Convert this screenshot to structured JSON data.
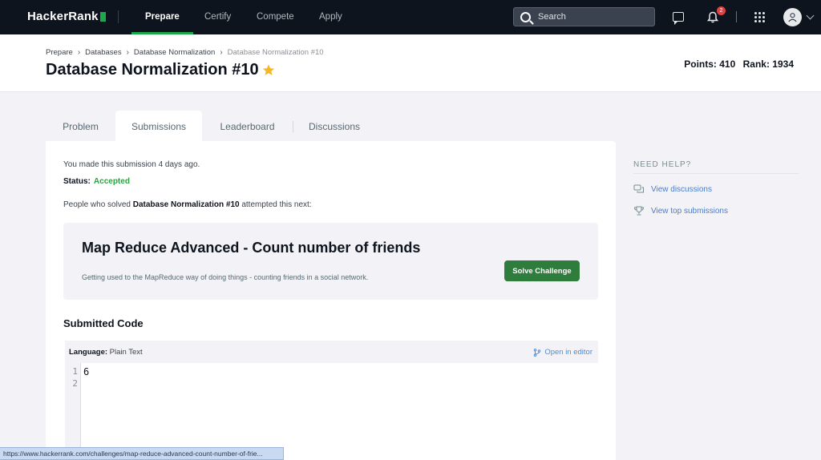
{
  "nav": {
    "brand": "HackerRank",
    "links": [
      "Prepare",
      "Certify",
      "Compete",
      "Apply"
    ],
    "search_placeholder": "Search",
    "notification_count": "2"
  },
  "header": {
    "breadcrumb": [
      "Prepare",
      "Databases",
      "Database Normalization",
      "Database Normalization #10"
    ],
    "title": "Database Normalization #10",
    "points_label": "Points: 410",
    "rank_label": "Rank: 1934"
  },
  "tabs": [
    "Problem",
    "Submissions",
    "Leaderboard",
    "Discussions"
  ],
  "submission": {
    "made_text": "You made this submission 4 days ago.",
    "status_label": "Status:",
    "status_value": "Accepted",
    "people_prefix": "People who solved ",
    "people_challenge": "Database Normalization #10",
    "people_suffix": " attempted this next:"
  },
  "next_challenge": {
    "title": "Map Reduce Advanced - Count number of friends",
    "description": "Getting used to the MapReduce way of doing things - counting friends in a social network.",
    "button": "Solve Challenge"
  },
  "code": {
    "title": "Submitted Code",
    "language_label": "Language:",
    "language_value": "Plain Text",
    "open_editor": "Open in editor",
    "lines": [
      "6",
      ""
    ]
  },
  "help": {
    "heading": "NEED HELP?",
    "links": [
      "View discussions",
      "View top submissions"
    ]
  },
  "status_url": "https://www.hackerrank.com/challenges/map-reduce-advanced-count-number-of-frie...",
  "colors": {
    "accent_green": "#1ba94c",
    "button_green": "#2e7d3c",
    "link_blue": "#4a7cc9",
    "nav_bg": "#0e141e"
  }
}
